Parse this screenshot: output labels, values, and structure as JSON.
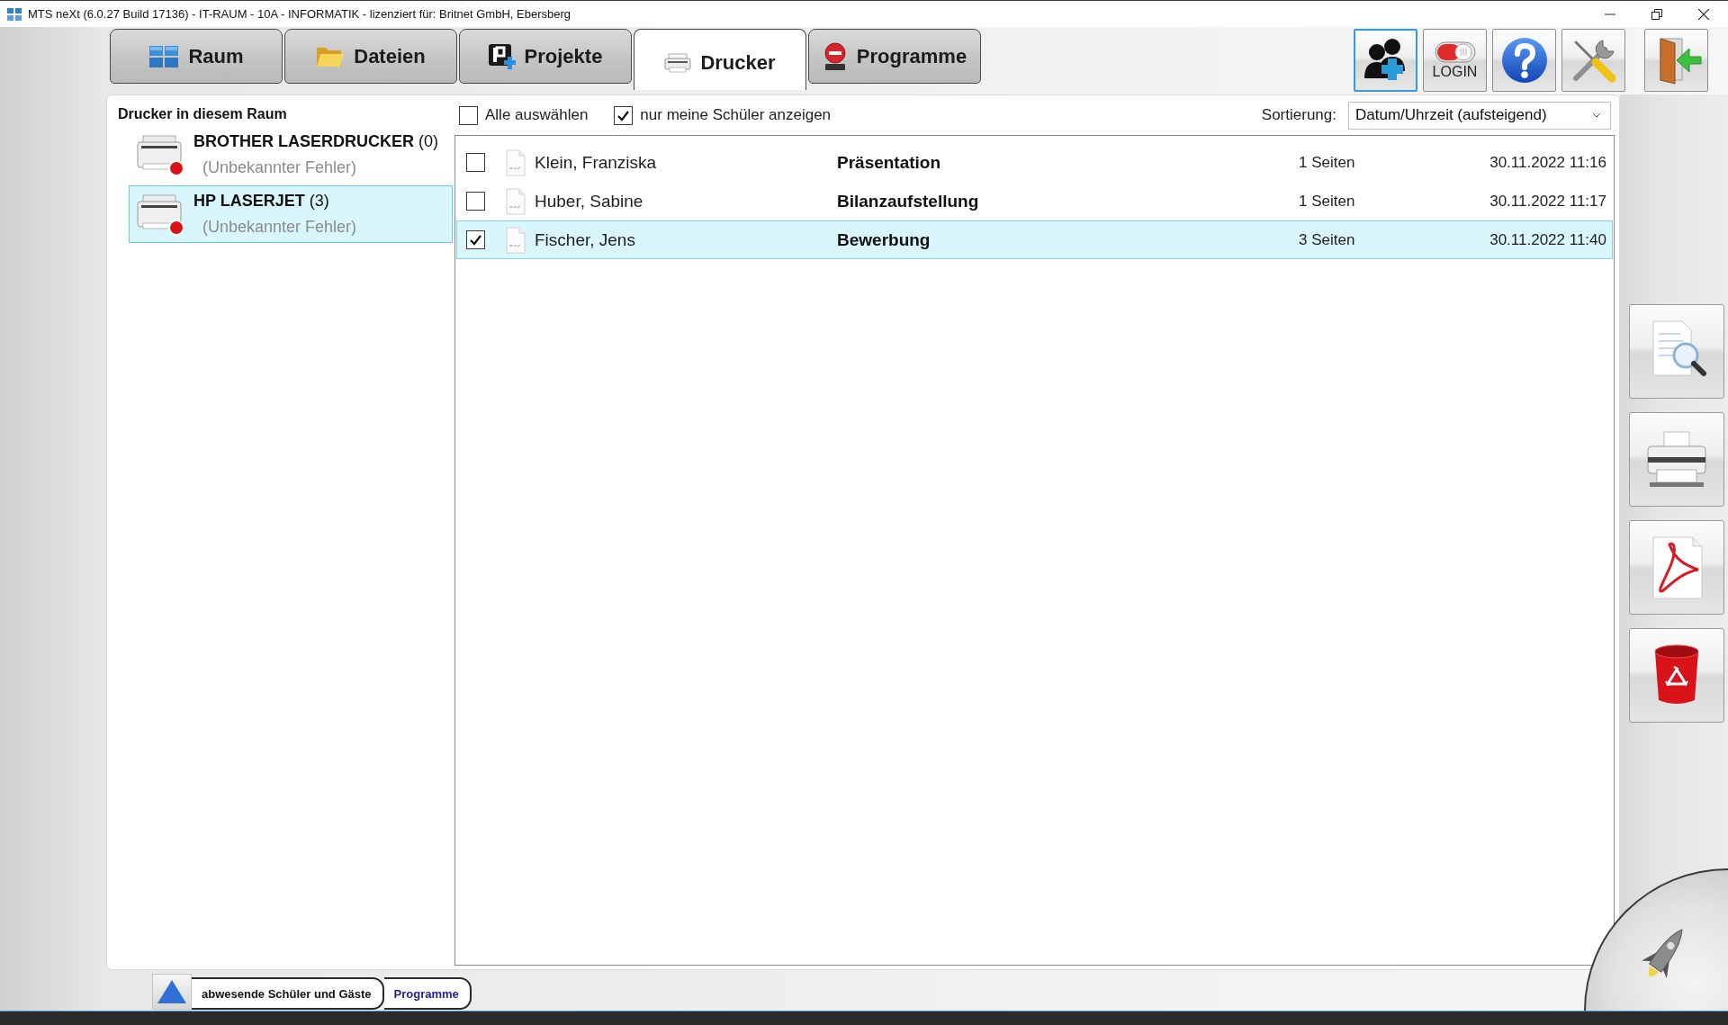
{
  "window": {
    "title": "MTS neXt (6.0.27 Build 17136) - IT-RAUM - 10A - INFORMATIK - lizenziert für: Britnet GmbH, Ebersberg"
  },
  "tabs": [
    {
      "label": "Raum",
      "selected": false
    },
    {
      "label": "Dateien",
      "selected": false
    },
    {
      "label": "Projekte",
      "selected": false
    },
    {
      "label": "Drucker",
      "selected": true
    },
    {
      "label": "Programme",
      "selected": false
    }
  ],
  "toolbar": [
    {
      "selected": true
    },
    {
      "label": "LOGIN",
      "selected": false
    },
    {
      "selected": false
    },
    {
      "selected": false
    },
    {
      "selected": false
    }
  ],
  "printers": {
    "heading": "Drucker in diesem Raum",
    "items": [
      {
        "name": "BROTHER LASERDRUCKER",
        "count": "(0)",
        "status": "(Unbekannter Fehler)",
        "selected": false
      },
      {
        "name": "HP LASERJET",
        "count": "(3)",
        "status": "(Unbekannter Fehler)",
        "selected": true
      }
    ]
  },
  "filters": [
    {
      "label": "Alle auswählen",
      "checked": false
    },
    {
      "label": "nur meine Schüler anzeigen",
      "checked": true
    }
  ],
  "sort": {
    "label": "Sortierung:",
    "value": "Datum/Uhrzeit (aufsteigend)"
  },
  "jobs": [
    {
      "student": "Klein, Franziska",
      "title": "Präsentation",
      "pages": "1 Seiten",
      "date": "30.11.2022 11:16",
      "checked": false,
      "selected": false
    },
    {
      "student": "Huber, Sabine",
      "title": "Bilanzaufstellung",
      "pages": "1 Seiten",
      "date": "30.11.2022 11:17",
      "checked": false,
      "selected": false
    },
    {
      "student": "Fischer, Jens",
      "title": "Bewerbung",
      "pages": "3 Seiten",
      "date": "30.11.2022 11:40",
      "checked": true,
      "selected": true
    }
  ],
  "bottom_tabs": [
    {
      "label": "abwesende Schüler und Gäste",
      "selected": false
    },
    {
      "label": "Programme",
      "selected": true
    }
  ]
}
